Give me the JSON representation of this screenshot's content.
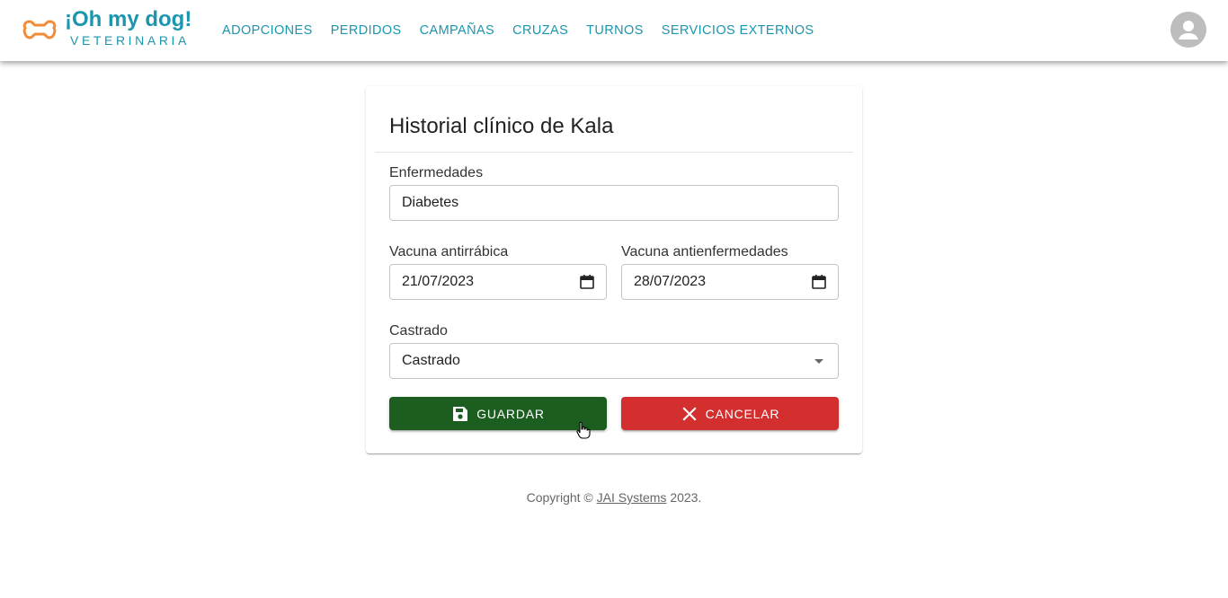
{
  "header": {
    "brand_title": "¡Oh my dog!",
    "brand_subtitle": "VETERINARIA",
    "nav": [
      {
        "label": "ADOPCIONES"
      },
      {
        "label": "PERDIDOS"
      },
      {
        "label": "CAMPAÑAS"
      },
      {
        "label": "CRUZAS"
      },
      {
        "label": "TURNOS"
      },
      {
        "label": "SERVICIOS EXTERNOS"
      }
    ]
  },
  "form": {
    "title": "Historial clínico de Kala",
    "enfermedades": {
      "label": "Enfermedades",
      "value": "Diabetes"
    },
    "vacuna_antirrabica": {
      "label": "Vacuna antirrábica",
      "value": "21/07/2023"
    },
    "vacuna_antienfermedades": {
      "label": "Vacuna antienfermedades",
      "value": "28/07/2023"
    },
    "castrado": {
      "label": "Castrado",
      "value": "Castrado"
    },
    "save_label": "GUARDAR",
    "cancel_label": "CANCELAR"
  },
  "footer": {
    "prefix": "Copyright ©",
    "link": "JAI Systems",
    "suffix": "2023."
  },
  "colors": {
    "brand": "#1b96ad",
    "logo": "#f28c38",
    "save": "#1b5e20",
    "cancel": "#d32f2f"
  },
  "icons": [
    "bone-icon",
    "account-circle-icon",
    "calendar-icon",
    "dropdown-arrow-icon",
    "save-icon",
    "close-icon",
    "hand-cursor-icon"
  ]
}
